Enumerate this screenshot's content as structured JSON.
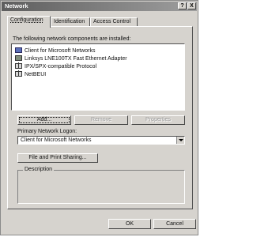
{
  "window": {
    "title": "Network",
    "help_label": "?",
    "close_label": "X"
  },
  "tabs": [
    {
      "label": "Configuration",
      "active": true
    },
    {
      "label": "Identification",
      "active": false
    },
    {
      "label": "Access Control",
      "active": false
    }
  ],
  "components": {
    "heading": "The following network components are installed:",
    "items": [
      {
        "label": "Client for Microsoft Networks",
        "icon": "client-icon"
      },
      {
        "label": "Linksys LNE100TX Fast Ethernet Adapter",
        "icon": "network-adapter-icon"
      },
      {
        "label": "IPX/SPX-compatible Protocol",
        "icon": "protocol-icon"
      },
      {
        "label": "NetBEUI",
        "icon": "protocol-icon"
      }
    ]
  },
  "buttons": {
    "add": "Add...",
    "remove": "Remove",
    "properties": "Properties",
    "file_print_sharing": "File and Print Sharing...",
    "ok": "OK",
    "cancel": "Cancel"
  },
  "logon": {
    "label": "Primary Network Logon:",
    "value": "Client for Microsoft Networks"
  },
  "description": {
    "label": "Description",
    "text": ""
  },
  "colors": {
    "title_bar_start": "#5e5e5e",
    "title_bar_end": "#9e9e9e",
    "dialog_face": "#d6d3ce"
  }
}
